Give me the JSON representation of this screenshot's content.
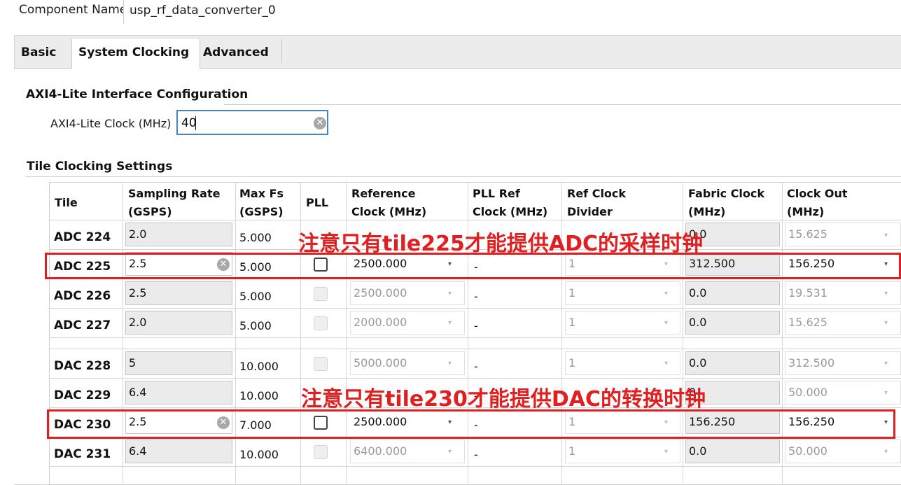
{
  "component": {
    "label": "Component Name",
    "value": "usp_rf_data_converter_0"
  },
  "tabs": [
    "Basic",
    "System Clocking",
    "Advanced"
  ],
  "axi": {
    "section_title": "AXI4-Lite Interface Configuration",
    "clock_label": "AXI4-Lite Clock (MHz)",
    "clock_value": "40"
  },
  "tile_section_title": "Tile Clocking Settings",
  "columns": {
    "tile": "Tile",
    "sampling_rate": [
      "Sampling Rate",
      "(GSPS)"
    ],
    "max_fs": [
      "Max Fs",
      "(GSPS)"
    ],
    "pll": "PLL",
    "ref_clock": [
      "Reference",
      "Clock (MHz)"
    ],
    "pll_ref_clock": [
      "PLL Ref",
      "Clock (MHz)"
    ],
    "ref_clock_divider": [
      "Ref Clock",
      "Divider"
    ],
    "fabric_clock": [
      "Fabric Clock",
      "(MHz)"
    ],
    "clock_out": [
      "Clock Out",
      "(MHz)"
    ]
  },
  "rows": [
    {
      "tile": "ADC 224",
      "sampling_rate": "2.0",
      "max_fs": "5.000",
      "ref_clock": "",
      "pll_ref_clock": "-",
      "divider": "1",
      "fabric_clock": "0.0",
      "clock_out": "15.625"
    },
    {
      "tile": "ADC 225",
      "sampling_rate": "2.5",
      "max_fs": "5.000",
      "ref_clock": "2500.000",
      "pll_ref_clock": "-",
      "divider": "1",
      "fabric_clock": "312.500",
      "clock_out": "156.250"
    },
    {
      "tile": "ADC 226",
      "sampling_rate": "2.5",
      "max_fs": "5.000",
      "ref_clock": "2500.000",
      "pll_ref_clock": "-",
      "divider": "1",
      "fabric_clock": "0.0",
      "clock_out": "19.531"
    },
    {
      "tile": "ADC 227",
      "sampling_rate": "2.0",
      "max_fs": "5.000",
      "ref_clock": "2000.000",
      "pll_ref_clock": "-",
      "divider": "1",
      "fabric_clock": "0.0",
      "clock_out": "15.625"
    },
    {
      "tile": "DAC 228",
      "sampling_rate": "5",
      "max_fs": "10.000",
      "ref_clock": "5000.000",
      "pll_ref_clock": "-",
      "divider": "1",
      "fabric_clock": "0.0",
      "clock_out": "312.500"
    },
    {
      "tile": "DAC 229",
      "sampling_rate": "6.4",
      "max_fs": "10.000",
      "ref_clock": "",
      "pll_ref_clock": "-",
      "divider": "1",
      "fabric_clock": "0",
      "clock_out": "50.000"
    },
    {
      "tile": "DAC 230",
      "sampling_rate": "2.5",
      "max_fs": "7.000",
      "ref_clock": "2500.000",
      "pll_ref_clock": "-",
      "divider": "1",
      "fabric_clock": "156.250",
      "clock_out": "156.250"
    },
    {
      "tile": "DAC 231",
      "sampling_rate": "6.4",
      "max_fs": "10.000",
      "ref_clock": "6400.000",
      "pll_ref_clock": "-",
      "divider": "1",
      "fabric_clock": "0.0",
      "clock_out": "50.000"
    }
  ],
  "annotations": {
    "adc_note": "注意只有tile225才能提供ADC的采样时钟",
    "dac_note": "注意只有tile230才能提供DAC的转换时钟",
    "color": "#e02020"
  },
  "icons": {
    "clear": "clear-circle-icon",
    "dropdown": "dropdown-arrow-icon"
  }
}
